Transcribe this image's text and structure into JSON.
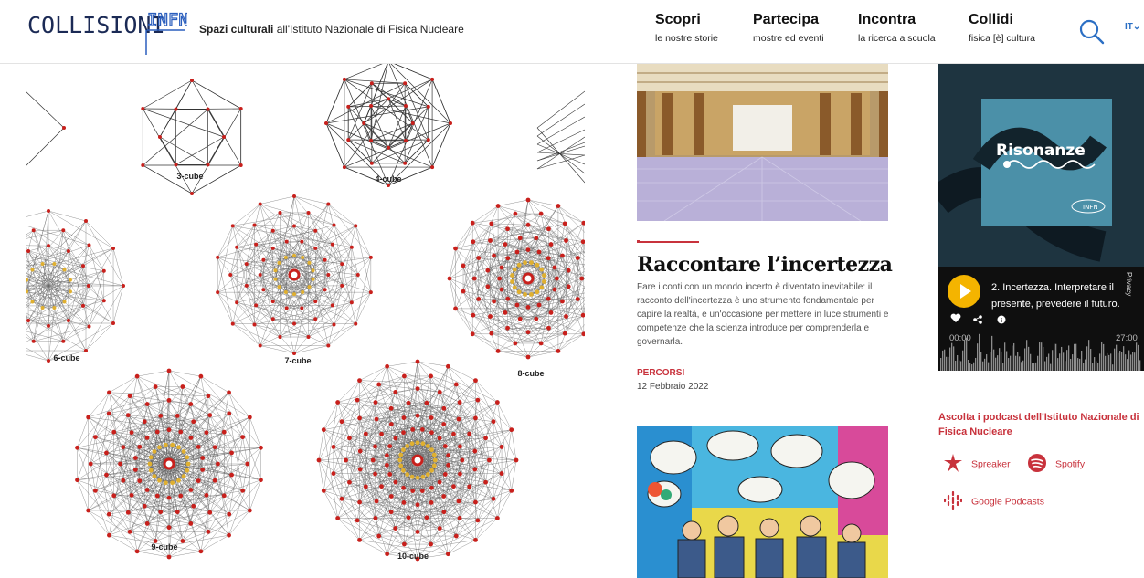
{
  "header": {
    "logo_text_a": "COLLISIONI",
    "logo_text_b": "INFN",
    "tagline_bold": "Spazi culturali",
    "tagline_rest": " all'Istituto Nazionale di Fisica Nucleare",
    "nav": [
      {
        "title": "Scopri",
        "subtitle": "le nostre storie"
      },
      {
        "title": "Partecipa",
        "subtitle": "mostre ed eventi"
      },
      {
        "title": "Incontra",
        "subtitle": "la ricerca a scuola"
      },
      {
        "title": "Collidi",
        "subtitle": "fisica [è] cultura"
      }
    ],
    "search_icon": "search-icon",
    "language": "IT"
  },
  "figure": {
    "labels": [
      "3-cube",
      "4-cube",
      "6-cube",
      "7-cube",
      "8-cube",
      "9-cube",
      "10-cube"
    ]
  },
  "article": {
    "title": "Raccontare l’incertezza",
    "excerpt": "Fare i conti con un mondo incerto è diventato inevitabile: il racconto dell'incertezza è uno strumento fondamentale per capire la realtà, e un'occasione per mettere in luce strumenti e competenze che la scienza introduce per comprenderla e governarla.",
    "category": "PERCORSI",
    "date": "12 Febbraio 2022"
  },
  "podcast": {
    "show": "Risonanze",
    "brand": "INFN",
    "episode": "2. Incertezza. Interpretare il presente, prevedere il futuro.",
    "time_current": "00:00",
    "time_total": "27:00",
    "privacy": "Privacy",
    "cta": "Ascolta i podcast dell'Istituto Nazionale di Fisica Nucleare",
    "links": [
      {
        "label": "Spreaker",
        "icon": "spreaker-icon"
      },
      {
        "label": "Spotify",
        "icon": "spotify-icon"
      },
      {
        "label": "Google Podcasts",
        "icon": "google-podcasts-icon"
      }
    ]
  },
  "colors": {
    "accent_red": "#c8323c",
    "podcast_yellow": "#f4b400",
    "podcast_teal": "#4b90a8"
  }
}
